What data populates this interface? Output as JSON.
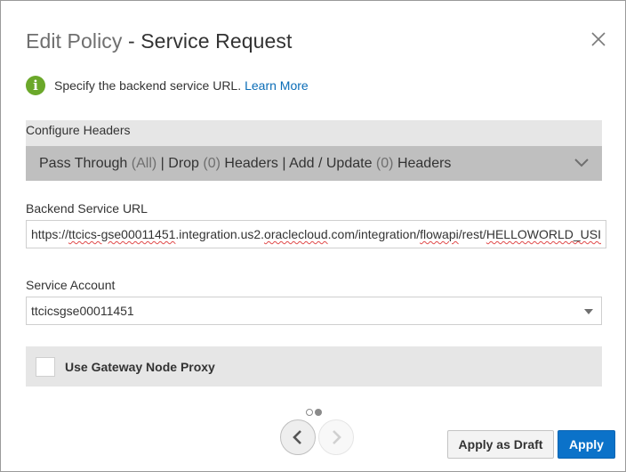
{
  "dialog": {
    "title_part1": "Edit Policy",
    "title_sep": " - ",
    "title_part2": "Service Request"
  },
  "info": {
    "icon": "info-icon",
    "icon_glyph": "i",
    "text": "Specify the backend service URL.",
    "link": "Learn More",
    "accent_color": "#6ba82a"
  },
  "headers": {
    "label": "Configure Headers",
    "dropdown": {
      "p1": "Pass Through",
      "p2": "(All)",
      "p3": "| Drop",
      "p4": "(0)",
      "p5": "Headers | Add / Update",
      "p6": "(0)",
      "p7": "Headers"
    },
    "icon": "chevron-down-icon"
  },
  "backend": {
    "label": "Backend Service URL",
    "url_prefix": "https://",
    "url_seg1": "ttcics-gse00011451",
    "url_seg2": ".integration.us2.",
    "url_seg3": "oraclecloud",
    "url_seg4": ".com/integration/",
    "url_seg5": "flowapi",
    "url_seg6": "/rest/",
    "url_seg7": "HELLOWORLD_USI"
  },
  "service_account": {
    "label": "Service Account",
    "value": "ttcicsgse00011451",
    "icon": "caret-down-icon"
  },
  "proxy": {
    "label": "Use Gateway Node Proxy",
    "checked": false
  },
  "pagination": {
    "current_page": 2,
    "total_pages": 2
  },
  "buttons": {
    "draft": "Apply as Draft",
    "apply": "Apply",
    "apply_color": "#0b72c9"
  }
}
